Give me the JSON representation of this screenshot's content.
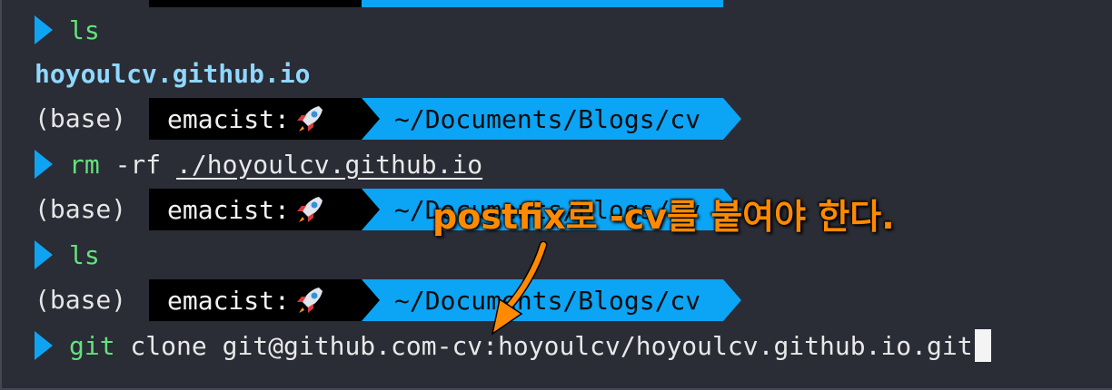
{
  "terminal": {
    "prompt": {
      "env": "(base)",
      "user": "emacist:",
      "path": "~/Documents/Blogs/cv"
    },
    "lines": [
      {
        "type": "command",
        "cmd": "ls",
        "args": ""
      },
      {
        "type": "output",
        "text": "hoyoulcv.github.io"
      },
      {
        "type": "prompt"
      },
      {
        "type": "command",
        "cmd": "rm",
        "args": " -rf ",
        "underlined_arg": "./hoyoulcv.github.io"
      },
      {
        "type": "prompt"
      },
      {
        "type": "command",
        "cmd": "ls",
        "args": ""
      },
      {
        "type": "prompt"
      },
      {
        "type": "command",
        "cmd": "git",
        "args": " clone git@github.com-cv:hoyoulcv/hoyoulcv.github.io.git"
      }
    ]
  },
  "annotation": {
    "text": "postfix로 -cv를 붙여야 한다.",
    "color": "#ff8a00"
  },
  "colors": {
    "background": "#2a2c36",
    "accent": "#0ca4f5",
    "command": "#63e27a"
  },
  "icons": {
    "rocket": "rocket-icon",
    "prompt": "triangle-right-icon"
  }
}
